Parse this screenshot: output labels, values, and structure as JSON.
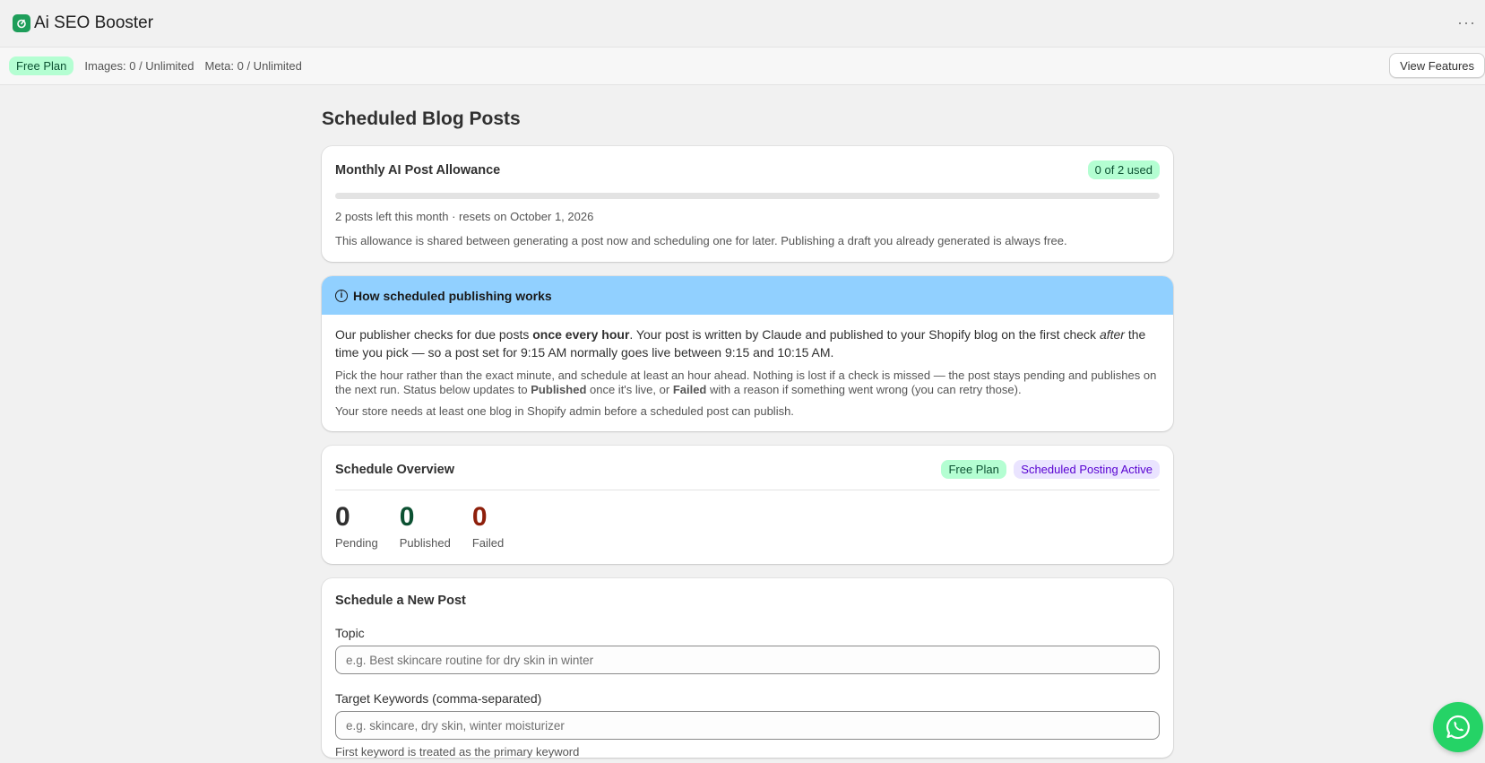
{
  "app": {
    "title": "Ai SEO Booster"
  },
  "planbar": {
    "plan_badge": "Free Plan",
    "images": "Images: 0 / Unlimited",
    "meta": "Meta: 0 / Unlimited",
    "view_features": "View Features"
  },
  "page": {
    "title": "Scheduled Blog Posts"
  },
  "allowance": {
    "title": "Monthly AI Post Allowance",
    "badge": "0 of 2 used",
    "used": 0,
    "total": 2,
    "progress_fraction": 0,
    "remaining_text": "2 posts left this month · resets on October 1, 2026",
    "note": "This allowance is shared between generating a post now and scheduling one for later. Publishing a draft you already generated is always free."
  },
  "info": {
    "title": "How scheduled publishing works",
    "p1_a": "Our publisher checks for due posts ",
    "p1_b": "once every hour",
    "p1_c": ". Your post is written by Claude and published to your Shopify blog on the first check ",
    "p1_d": "after",
    "p1_e": " the time you pick — so a post set for 9:15 AM normally goes live between 9:15 and 10:15 AM.",
    "p2_a": "Pick the hour rather than the exact minute, and schedule at least an hour ahead. Nothing is lost if a check is missed — the post stays pending and publishes on the next run. Status below updates to ",
    "p2_b": "Published",
    "p2_c": " once it's live, or ",
    "p2_d": "Failed",
    "p2_e": " with a reason if something went wrong (you can retry those).",
    "p3": "Your store needs at least one blog in Shopify admin before a scheduled post can publish."
  },
  "overview": {
    "title": "Schedule Overview",
    "plan_badge": "Free Plan",
    "status_badge": "Scheduled Posting Active",
    "stats": [
      {
        "value": "0",
        "label": "Pending",
        "color": "#303030"
      },
      {
        "value": "0",
        "label": "Published",
        "color": "#0c5132"
      },
      {
        "value": "0",
        "label": "Failed",
        "color": "#8e1f0b"
      }
    ]
  },
  "new_post": {
    "title": "Schedule a New Post",
    "topic_label": "Topic",
    "topic_placeholder": "e.g. Best skincare routine for dry skin in winter",
    "topic_value": "",
    "keywords_label": "Target Keywords (comma-separated)",
    "keywords_placeholder": "e.g. skincare, dry skin, winter moisturizer",
    "keywords_value": "",
    "keywords_help": "First keyword is treated as the primary keyword"
  },
  "colors": {
    "accent_green": "#1e9e5a",
    "info_blue": "#91d0ff",
    "whatsapp": "#25d366"
  }
}
